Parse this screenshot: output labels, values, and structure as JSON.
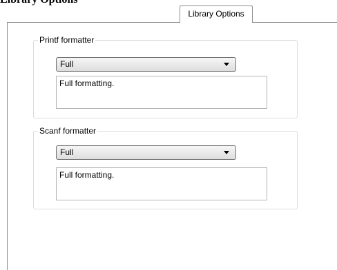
{
  "header": {
    "cut_off_text": "Library Options"
  },
  "tabs": [
    {
      "label": "Library Options",
      "selected": true
    }
  ],
  "printf_group": {
    "label": "Printf formatter",
    "selected_value": "Full",
    "description": "Full formatting."
  },
  "scanf_group": {
    "label": "Scanf formatter",
    "selected_value": "Full",
    "description": "Full formatting."
  },
  "icons": {
    "dropdown_arrow": "chevron-down-icon"
  }
}
